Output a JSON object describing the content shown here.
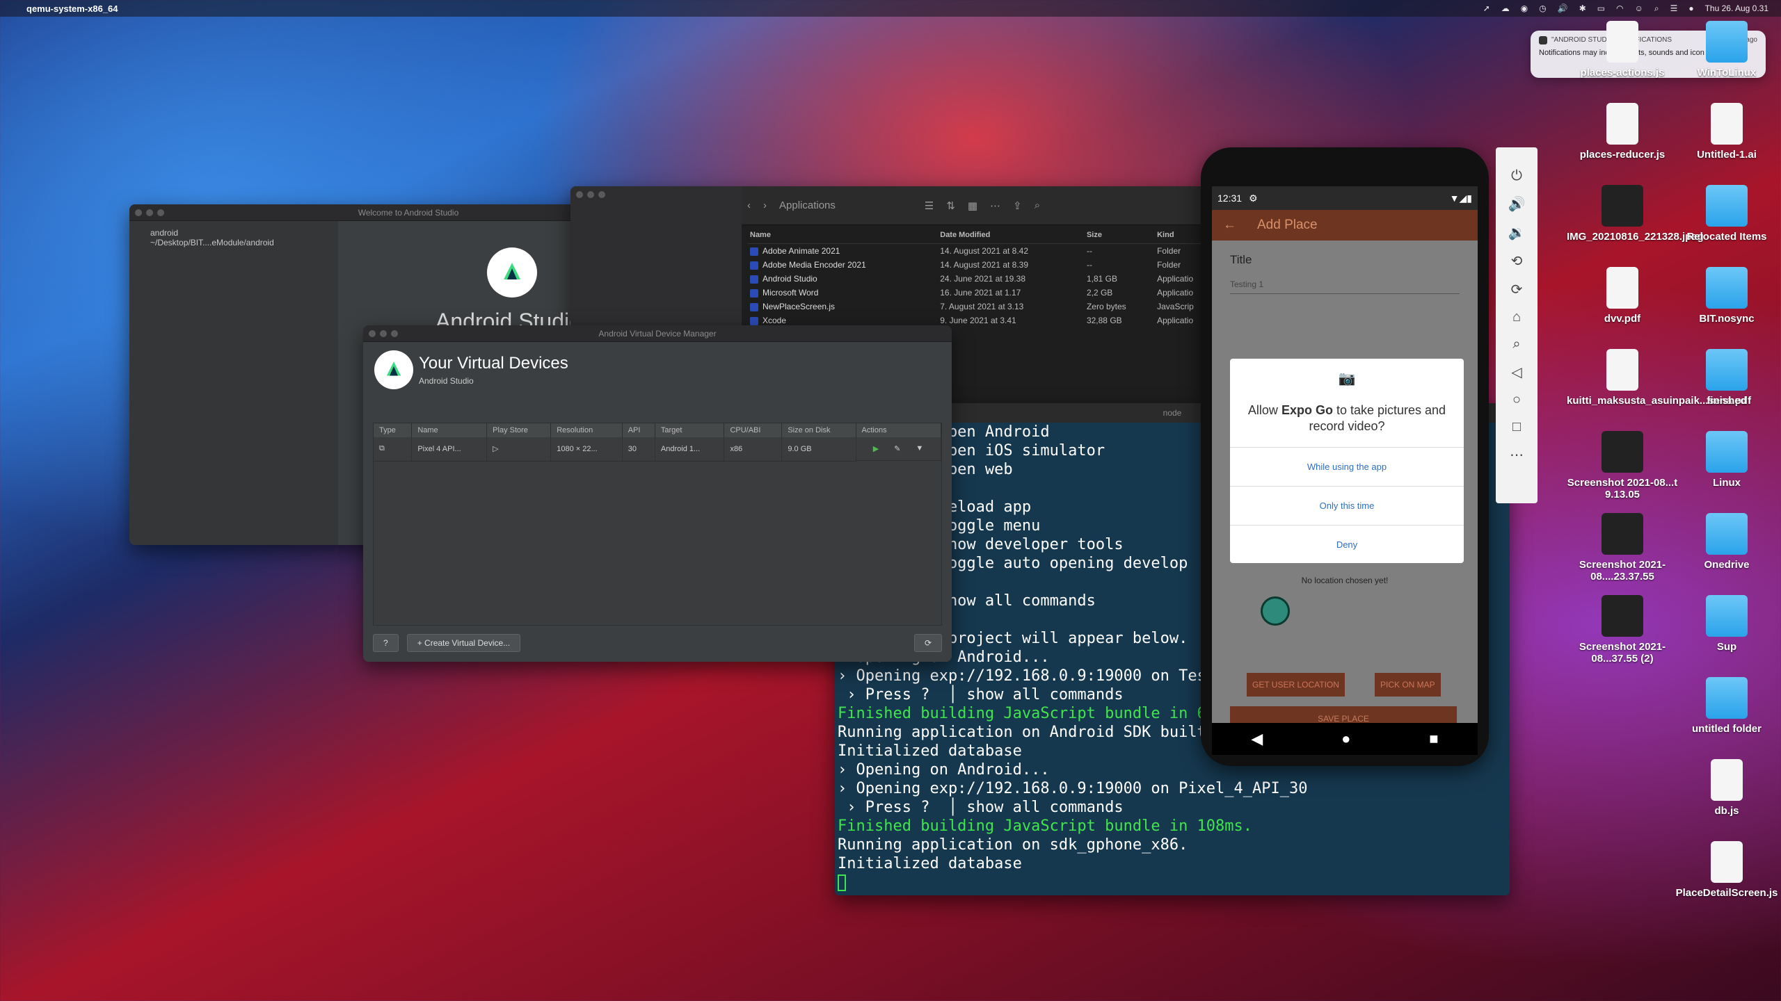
{
  "menubar": {
    "app_name": "qemu-system-x86_64",
    "datetime": "Thu 26. Aug  0.31"
  },
  "notification": {
    "header": "\"ANDROID STUDIO\" NOTIFICATIONS",
    "time": "24m ago",
    "body": "Notifications may include alerts, sounds and icon badges."
  },
  "welcome": {
    "window_title": "Welcome to Android Studio",
    "recent_project_name": "android",
    "recent_project_path": "~/Desktop/BIT....eModule/android",
    "app_title": "Android Studio"
  },
  "finder": {
    "location": "Applications",
    "columns": [
      "Name",
      "Date Modified",
      "Size",
      "Kind"
    ],
    "rows": [
      [
        "Adobe Animate 2021",
        "14. August 2021 at 8.42",
        "--",
        "Folder"
      ],
      [
        "Adobe Media Encoder 2021",
        "14. August 2021 at 8.39",
        "--",
        "Folder"
      ],
      [
        "Android Studio",
        "24. June 2021 at 19.38",
        "1,81 GB",
        "Applicatio"
      ],
      [
        "Microsoft Word",
        "16. June 2021 at 1.17",
        "2,2 GB",
        "Applicatio"
      ],
      [
        "NewPlaceScreen.js",
        "7. August 2021 at 3.13",
        "Zero bytes",
        "JavaScrip"
      ],
      [
        "Xcode",
        "9. June 2021 at 3.41",
        "32,88 GB",
        "Applicatio"
      ]
    ]
  },
  "avd": {
    "window_title": "Android Virtual Device Manager",
    "heading": "Your Virtual Devices",
    "subheading": "Android Studio",
    "columns": [
      "Type",
      "Name",
      "Play Store",
      "Resolution",
      "API",
      "Target",
      "CPU/ABI",
      "Size on Disk",
      "Actions"
    ],
    "device": {
      "name": "Pixel 4 API...",
      "resolution": "1080 × 22...",
      "api": "30",
      "target": "Android 1...",
      "cpu": "x86",
      "size": "9.0 GB"
    },
    "help_label": "?",
    "create_label": "+ Create Virtual Device..."
  },
  "terminal": {
    "title": "node",
    "lines_top": [
      "           open Android",
      "           open iOS simulator",
      "           open web",
      "",
      "           reload app",
      "           toggle menu",
      "           show developer tools",
      "           toggle auto opening develop",
      "",
      "           show all commands",
      "",
      "            project will appear below.",
      "  Opening on Android...",
      "› Opening exp://192.168.0.9:19000 on Tes",
      " › Press ?  │ show all commands"
    ],
    "line_green1": "Finished building JavaScript bundle in 6",
    "lines_mid": [
      "Running application on Android SDK built",
      "Initialized database",
      "› Opening on Android...",
      "› Opening exp://192.168.0.9:19000 on Pixel_4_API_30",
      " › Press ?  │ show all commands"
    ],
    "line_green2": "Finished building JavaScript bundle in 108ms.",
    "lines_end": [
      "Running application on sdk_gphone_x86.",
      "Initialized database"
    ]
  },
  "phone": {
    "time": "12:31",
    "appbar_title": "Add Place",
    "title_label": "Title",
    "title_value": "Testing 1",
    "dialog_question_prefix": "Allow ",
    "dialog_app": "Expo Go",
    "dialog_question_suffix": " to take pictures and record video?",
    "option_while_using": "While using the app",
    "option_once": "Only this time",
    "option_deny": "Deny",
    "no_location": "No location chosen yet!",
    "btn_get_location": "GET USER LOCATION",
    "btn_pick_on_map": "PICK ON MAP",
    "btn_save": "SAVE PLACE"
  },
  "desktop": {
    "icons": [
      {
        "label": "places-actions.js",
        "kind": "doc"
      },
      {
        "label": "WinToLinux",
        "kind": "folder"
      },
      {
        "label": "places-reducer.js",
        "kind": "doc"
      },
      {
        "label": "Untitled-1.ai",
        "kind": "doc"
      },
      {
        "label": "IMG_20210816_221328.jpeg",
        "kind": "img"
      },
      {
        "label": "Relocated Items",
        "kind": "folder"
      },
      {
        "label": "dvv.pdf",
        "kind": "doc"
      },
      {
        "label": "BIT.nosync",
        "kind": "folder"
      },
      {
        "label": "kuitti_maksusta_asuinpaik...sena.pdf",
        "kind": "doc"
      },
      {
        "label": "finished",
        "kind": "folder"
      },
      {
        "label": "Screenshot 2021-08...t 9.13.05",
        "kind": "img"
      },
      {
        "label": "Linux",
        "kind": "folder"
      },
      {
        "label": "Screenshot 2021-08....23.37.55",
        "kind": "img"
      },
      {
        "label": "Onedrive",
        "kind": "folder"
      },
      {
        "label": "Screenshot 2021-08...37.55 (2)",
        "kind": "img"
      },
      {
        "label": "Sup",
        "kind": "folder"
      },
      {
        "label": "untitled folder",
        "kind": "folder"
      },
      {
        "label": "db.js",
        "kind": "doc"
      },
      {
        "label": "PlaceDetailScreen.js",
        "kind": "doc"
      }
    ]
  },
  "colors": {
    "term_green": "#3fe54b",
    "appbar": "#6e3620",
    "dialog_link": "#2f6fc3"
  }
}
